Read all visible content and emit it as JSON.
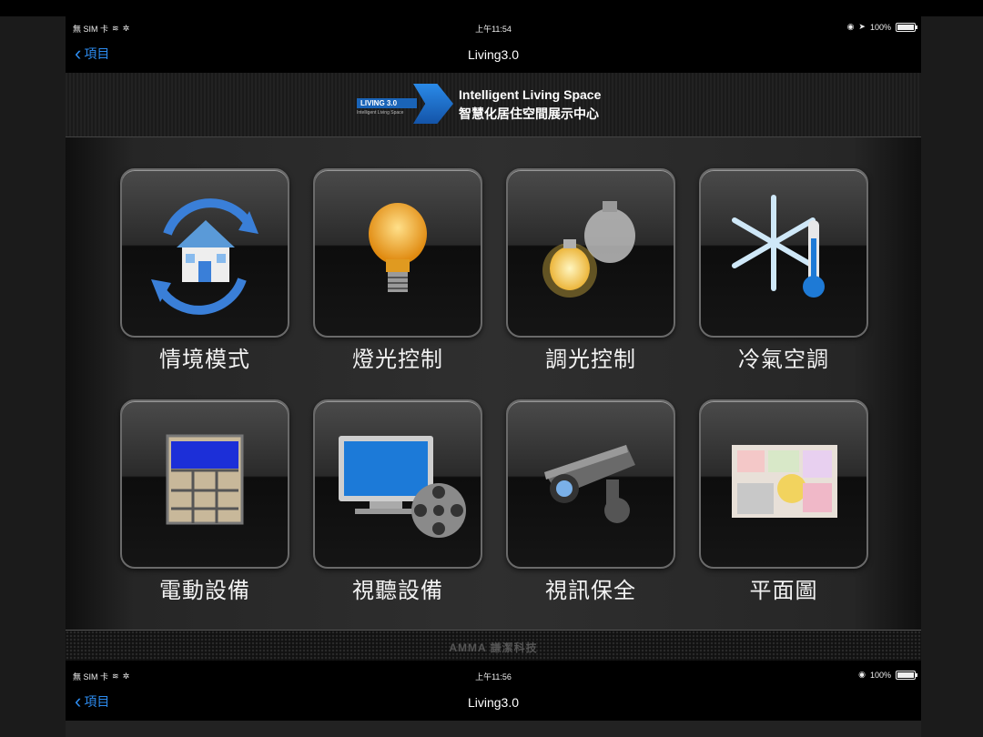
{
  "screen1": {
    "status": {
      "carrier": "無 SIM 卡",
      "time": "上午11:54",
      "battery": "100%"
    },
    "nav": {
      "back_label": "項目",
      "title": "Living3.0"
    },
    "logo": {
      "badge": "LIVING 3.0",
      "badge_sub": "Intelligent Living Space",
      "title_en": "Intelligent Living Space",
      "title_zh": "智慧化居住空間展示中心"
    },
    "tiles": [
      {
        "label": "情境模式",
        "icon": "house-cycle-icon"
      },
      {
        "label": "燈光控制",
        "icon": "lightbulb-icon"
      },
      {
        "label": "調光控制",
        "icon": "dimmer-bulbs-icon"
      },
      {
        "label": "冷氣空調",
        "icon": "snowflake-thermometer-icon"
      },
      {
        "label": "電動設備",
        "icon": "window-shade-icon"
      },
      {
        "label": "視聽設備",
        "icon": "tv-film-reel-icon"
      },
      {
        "label": "視訊保全",
        "icon": "security-camera-icon"
      },
      {
        "label": "平面圖",
        "icon": "floor-plan-icon"
      }
    ],
    "footer_brand": "AMMA 謙潔科技"
  },
  "screen2": {
    "status": {
      "carrier": "無 SIM 卡",
      "time": "上午11:56",
      "battery": "100%"
    },
    "nav": {
      "back_label": "項目",
      "title": "Living3.0"
    }
  },
  "colors": {
    "accent": "#2d8cf0",
    "brand_blue": "#1e74d6"
  }
}
